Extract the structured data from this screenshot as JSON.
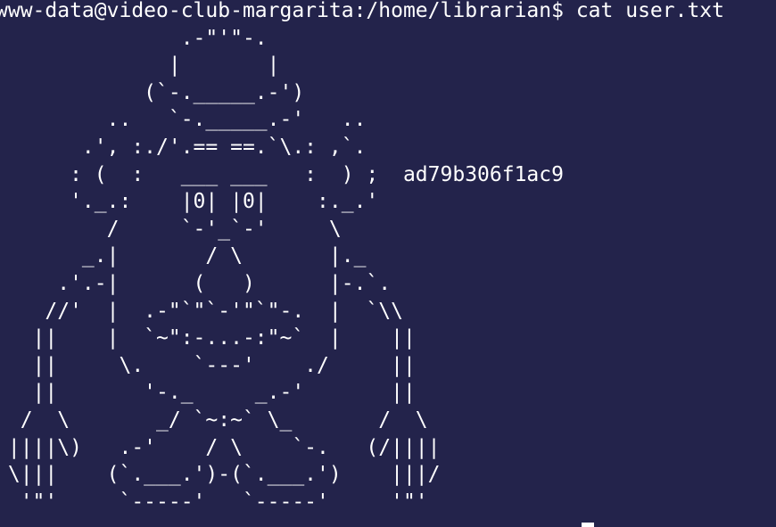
{
  "terminal": {
    "prompt": "www-data@video-club-margarita:/home/librarian$ ",
    "command": "cat user.txt",
    "output_lines": [
      "               .-\"'\"-.",
      "              |       |",
      "            (`-._____.-')",
      "         ..   `-._____.-'   ..",
      "       .', :./'.== ==.`\\.: ,`.",
      "      : (  :   ___ ___   :  ) ;  ad79b306f1ac9",
      "      '._.:    |0| |0|    :._.'",
      "         /     `-'_`-'     \\",
      "       _.|       / \\       |._",
      "     .'.-|      (   )      |-.`.",
      "    //'  |  .-\"`\"`-'\"`\"-.  |  `\\\\",
      "   ||    |  `~\":-...-:\"~`  |    ||",
      "   ||     \\.    `---'    ./     ||",
      "   ||       '-._     _.-'       ||",
      "  /  \\       _/ `~:~` \\_       /  \\",
      " ||||\\)   .-'    / \\    `-.   (/||||",
      " \\|||    (`.___.')-(`.___.')    |||/",
      "  '\"'     `-----'   `-----'     '\"'"
    ]
  }
}
